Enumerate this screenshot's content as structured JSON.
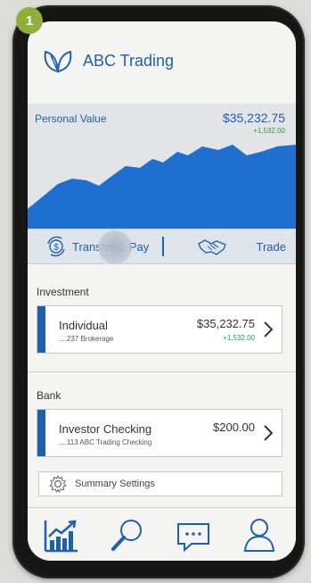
{
  "step": {
    "number": "1"
  },
  "app": {
    "title": "ABC Trading",
    "logo_icon": "leaf-logo-icon",
    "brand_color": "#1f5fb0"
  },
  "personal_value": {
    "label": "Personal Value",
    "value": "$35,232.75",
    "change": "+1,532.00",
    "change_color": "#1aa34a"
  },
  "actions": {
    "transfer_label": "Transfer & Pay",
    "transfer_icon": "dollar-exchange-icon",
    "trade_label": "Trade",
    "trade_icon": "handshake-icon"
  },
  "investment": {
    "section_title": "Investment",
    "account": {
      "name": "Individual",
      "sub": "....237 Brokerage",
      "amount": "$35,232.75",
      "change": "+1,532.00"
    }
  },
  "bank": {
    "section_title": "Bank",
    "account": {
      "name": "Investor Checking",
      "sub": "....113 ABC Trading Checking",
      "amount": "$200.00"
    }
  },
  "settings": {
    "label": "Summary Settings",
    "icon": "gear-icon"
  },
  "tabbar": {
    "tabs": [
      {
        "icon": "chart-growth-icon",
        "active": true
      },
      {
        "icon": "search-icon",
        "active": false
      },
      {
        "icon": "message-icon",
        "active": false
      },
      {
        "icon": "profile-icon",
        "active": false
      }
    ]
  }
}
